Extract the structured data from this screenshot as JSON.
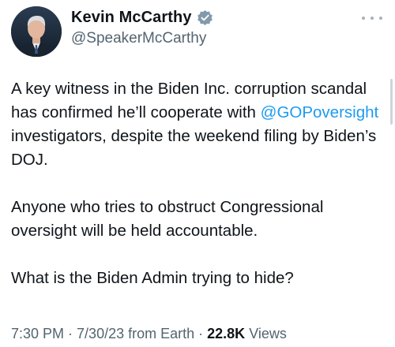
{
  "author": {
    "name": "Kevin McCarthy",
    "handle": "@SpeakerMcCarthy",
    "verified": true
  },
  "tweet": {
    "p1_before": "A key witness in the Biden Inc. corruption scandal has confirmed he’ll cooperate with ",
    "p1_mention": "@GOPoversight",
    "p1_after": " investigators, despite the weekend filing by Biden’s DOJ.",
    "p2": "Anyone who tries to obstruct Congressional oversight will be held accountable.",
    "p3": "What is the Biden Admin trying to hide?"
  },
  "meta": {
    "time": "7:30 PM",
    "sep1": " · ",
    "date": "7/30/23",
    "source": " from Earth",
    "sep2": " · ",
    "views_count": "22.8K",
    "views_label": " Views"
  },
  "colors": {
    "link": "#1d9bf0",
    "secondary": "#536471",
    "verified": "#829aab"
  }
}
